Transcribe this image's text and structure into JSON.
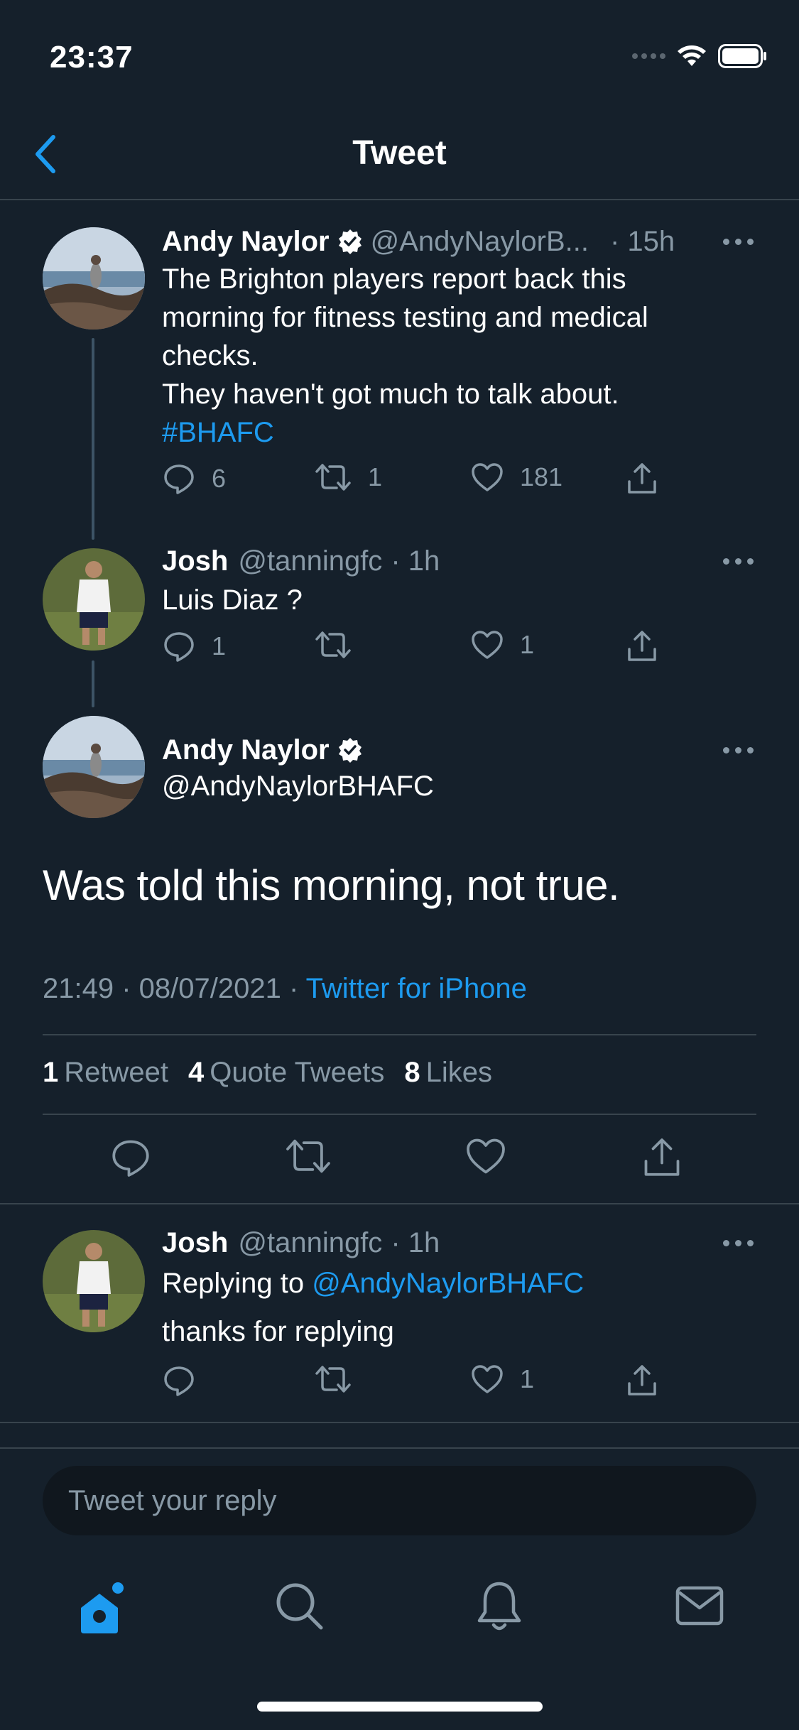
{
  "status_bar": {
    "time": "23:37"
  },
  "header": {
    "title": "Tweet"
  },
  "thread": [
    {
      "name": "Andy Naylor",
      "handle": "@AndyNaylorB...",
      "time": "· 15h",
      "text_lines": [
        "The Brighton players report back this",
        "morning for fitness testing and medical",
        "checks.",
        "They haven't got much to talk about."
      ],
      "hashtag": "#BHAFC",
      "replies": "6",
      "retweets": "1",
      "likes": "181"
    },
    {
      "name": "Josh",
      "handle": "@tanningfc",
      "time": "· 1h",
      "text": "Luis Diaz ?",
      "replies": "1",
      "retweets": "",
      "likes": "1"
    }
  ],
  "main_tweet": {
    "name": "Andy Naylor",
    "handle": "@AndyNaylorBHAFC",
    "text": "Was told this morning, not true.",
    "timestamp": "21:49 · 08/07/2021 · ",
    "source": "Twitter for iPhone",
    "stats": {
      "retweets_count": "1",
      "retweets_label": "Retweet",
      "quotes_count": "4",
      "quotes_label": "Quote Tweets",
      "likes_count": "8",
      "likes_label": "Likes"
    }
  },
  "reply": {
    "name": "Josh",
    "handle": "@tanningfc",
    "time": "· 1h",
    "replying_prefix": "Replying to ",
    "replying_to": "@AndyNaylorBHAFC",
    "text": "thanks for replying",
    "likes": "1"
  },
  "reply_input": {
    "placeholder": "Tweet your reply"
  },
  "colors": {
    "background": "#15202b",
    "accent": "#1d9bf0",
    "secondary_text": "#8899a6",
    "divider": "#38444d"
  },
  "tabs": [
    "home-icon",
    "search-icon",
    "bell-icon",
    "mail-icon"
  ]
}
